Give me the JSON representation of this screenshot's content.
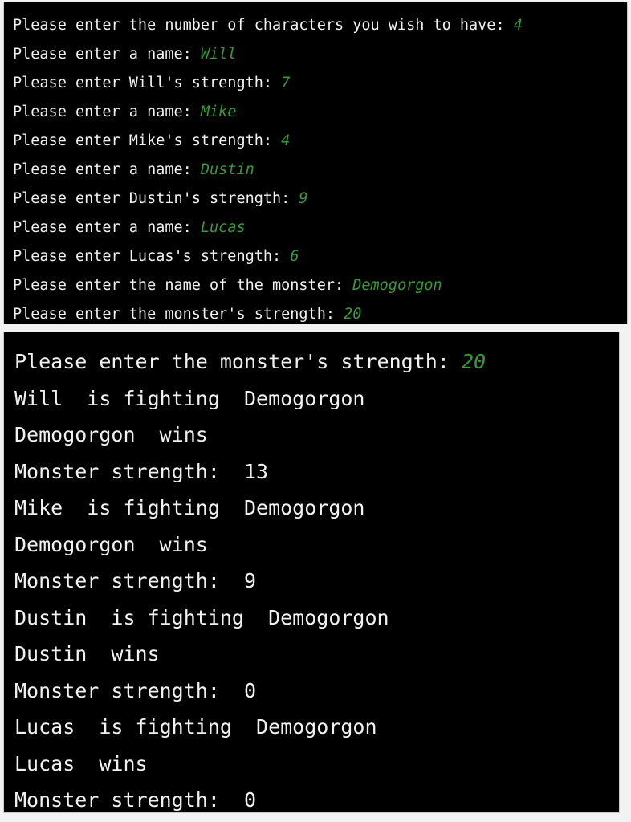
{
  "colors": {
    "terminal_background": "#000000",
    "prompt_text": "#f1f1f1",
    "user_input_text": "#3a9a3a",
    "page_background": "#f2f2f2",
    "panel_border": "#c9c9c9"
  },
  "panel_input": {
    "name": "input-transcript-panel",
    "lines": [
      {
        "prompt": "Please enter the number of characters you wish to have: ",
        "answer": "4"
      },
      {
        "prompt": "Please enter a name: ",
        "answer": "Will"
      },
      {
        "prompt": "Please enter Will's strength: ",
        "answer": "7"
      },
      {
        "prompt": "Please enter a name: ",
        "answer": "Mike"
      },
      {
        "prompt": "Please enter Mike's strength: ",
        "answer": "4"
      },
      {
        "prompt": "Please enter a name: ",
        "answer": "Dustin"
      },
      {
        "prompt": "Please enter Dustin's strength: ",
        "answer": "9"
      },
      {
        "prompt": "Please enter a name: ",
        "answer": "Lucas"
      },
      {
        "prompt": "Please enter Lucas's strength: ",
        "answer": "6"
      },
      {
        "prompt": "Please enter the name of the monster: ",
        "answer": "Demogorgon"
      },
      {
        "prompt": "Please enter the monster's strength: ",
        "answer": "20"
      }
    ]
  },
  "panel_output": {
    "name": "battle-output-panel",
    "lines": [
      {
        "prompt": "Please enter the monster's strength: ",
        "answer": "20"
      },
      {
        "text": "Will  is fighting  Demogorgon"
      },
      {
        "text": "Demogorgon  wins"
      },
      {
        "text": "Monster strength:  13"
      },
      {
        "text": "Mike  is fighting  Demogorgon"
      },
      {
        "text": "Demogorgon  wins"
      },
      {
        "text": "Monster strength:  9"
      },
      {
        "text": "Dustin  is fighting  Demogorgon"
      },
      {
        "text": "Dustin  wins"
      },
      {
        "text": "Monster strength:  0"
      },
      {
        "text": "Lucas  is fighting  Demogorgon"
      },
      {
        "text": "Lucas  wins"
      },
      {
        "text": "Monster strength:  0"
      }
    ]
  },
  "program_state": {
    "character_count": "4",
    "characters": [
      {
        "name": "Will",
        "strength": "7"
      },
      {
        "name": "Mike",
        "strength": "4"
      },
      {
        "name": "Dustin",
        "strength": "9"
      },
      {
        "name": "Lucas",
        "strength": "6"
      }
    ],
    "monster": {
      "name": "Demogorgon",
      "strength": "20"
    },
    "battles": [
      {
        "character": "Will",
        "winner": "Demogorgon",
        "monster_strength_after": "13"
      },
      {
        "character": "Mike",
        "winner": "Demogorgon",
        "monster_strength_after": "9"
      },
      {
        "character": "Dustin",
        "winner": "Dustin",
        "monster_strength_after": "0"
      },
      {
        "character": "Lucas",
        "winner": "Lucas",
        "monster_strength_after": "0"
      }
    ]
  }
}
